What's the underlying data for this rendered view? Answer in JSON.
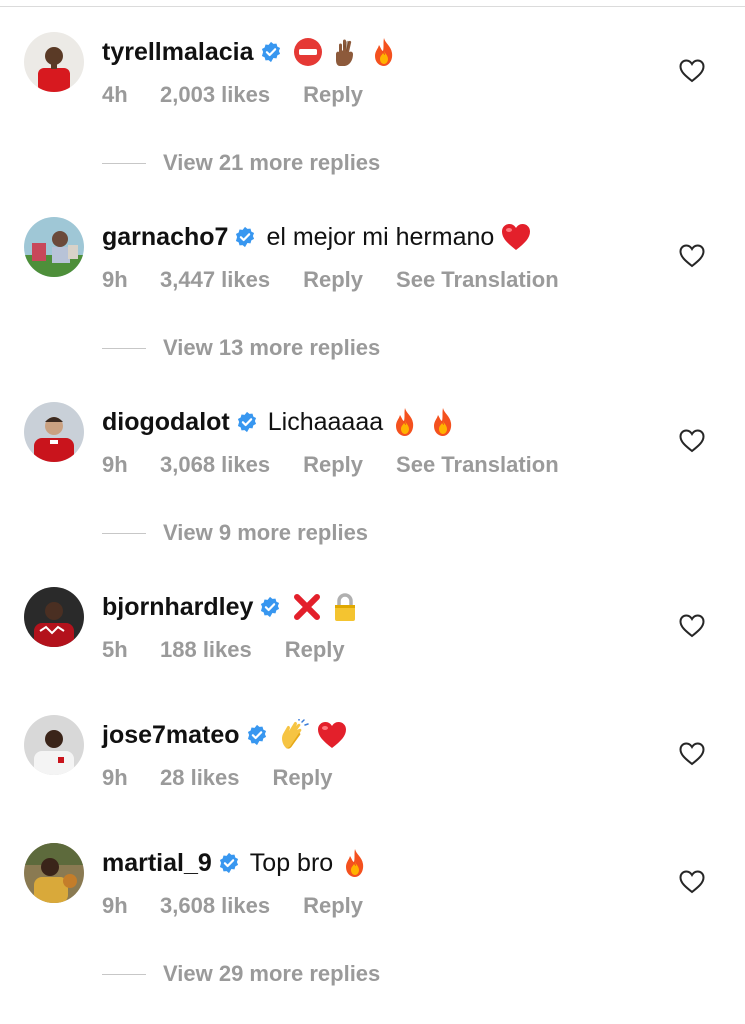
{
  "comments": [
    {
      "username": "tyrellmalacia",
      "text": "",
      "emojis": [
        "no-entry-emoji",
        "crossed-fingers-emoji",
        "fire-emoji"
      ],
      "time": "4h",
      "likes": "2,003 likes",
      "reply": "Reply",
      "translation": "",
      "view_more": "View 21 more replies"
    },
    {
      "username": "garnacho7",
      "text": "el mejor mi hermano",
      "emojis": [
        "red-heart-emoji"
      ],
      "time": "9h",
      "likes": "3,447 likes",
      "reply": "Reply",
      "translation": "See Translation",
      "view_more": "View 13 more replies"
    },
    {
      "username": "diogodalot",
      "text": "Lichaaaaa",
      "emojis": [
        "fire-emoji",
        "fire-emoji"
      ],
      "time": "9h",
      "likes": "3,068 likes",
      "reply": "Reply",
      "translation": "See Translation",
      "view_more": "View 9 more replies"
    },
    {
      "username": "bjornhardley",
      "text": "",
      "emojis": [
        "cross-mark-emoji",
        "lock-emoji"
      ],
      "time": "5h",
      "likes": "188 likes",
      "reply": "Reply",
      "translation": "",
      "view_more": ""
    },
    {
      "username": "jose7mateo",
      "text": "",
      "emojis": [
        "clapping-hands-emoji",
        "red-heart-emoji"
      ],
      "time": "9h",
      "likes": "28 likes",
      "reply": "Reply",
      "translation": "",
      "view_more": ""
    },
    {
      "username": "martial_9",
      "text": "Top bro",
      "emojis": [
        "fire-emoji"
      ],
      "time": "9h",
      "likes": "3,608 likes",
      "reply": "Reply",
      "translation": "",
      "view_more": "View 29 more replies"
    }
  ],
  "colors": {
    "verified": "#3897f0",
    "meta_text": "#9a9a9a",
    "username": "#111111",
    "heart_outline": "#262626"
  },
  "icons": {
    "verified": "verified-badge-icon",
    "like": "heart-outline-icon"
  }
}
